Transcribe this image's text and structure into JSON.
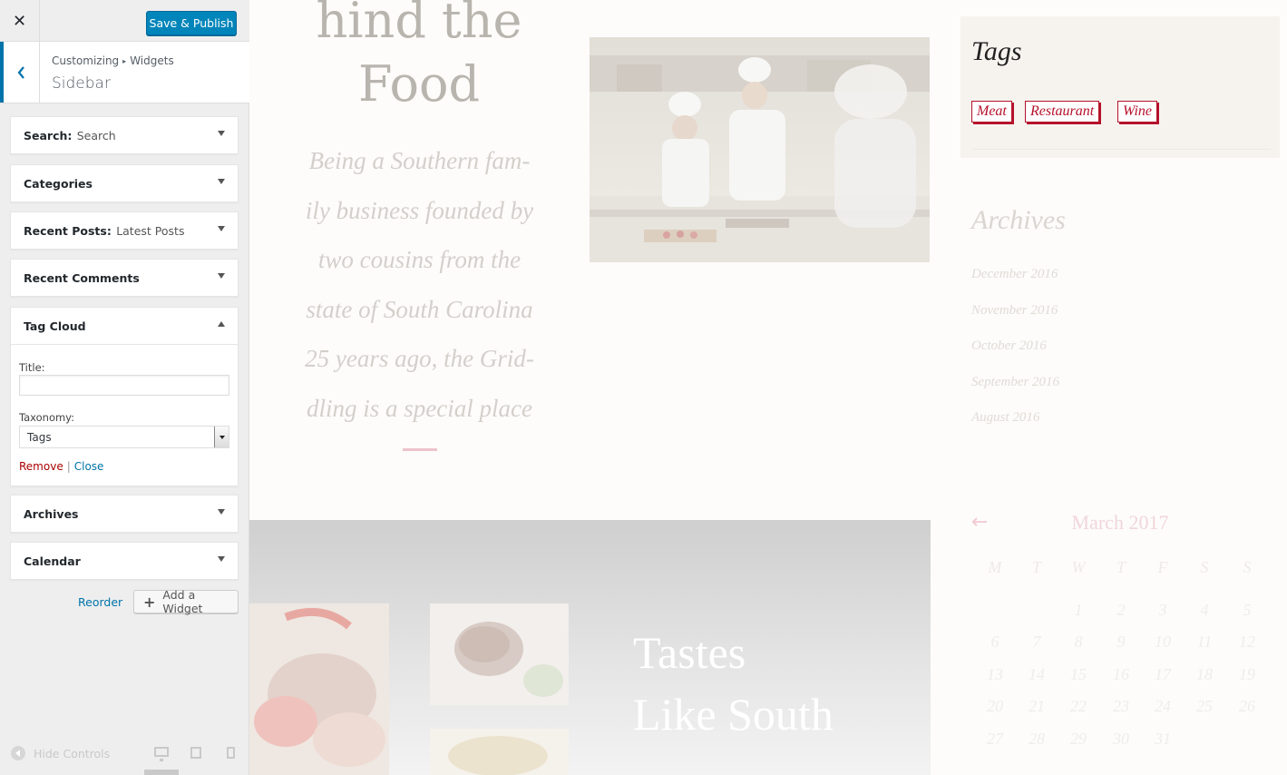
{
  "header": {
    "close_icon": "close-icon",
    "save_label": "Save & Publish"
  },
  "section": {
    "breadcrumb_root": "Customizing",
    "breadcrumb_separator": "▸",
    "breadcrumb_child": "Widgets",
    "title": "Sidebar"
  },
  "widgets": [
    {
      "title": "Search",
      "subtitle": "Search"
    },
    {
      "title": "Categories",
      "subtitle": ""
    },
    {
      "title": "Recent Posts",
      "subtitle": "Latest Posts"
    },
    {
      "title": "Recent Comments",
      "subtitle": ""
    },
    {
      "title": "Tag Cloud",
      "subtitle": ""
    },
    {
      "title": "Archives",
      "subtitle": ""
    },
    {
      "title": "Calendar",
      "subtitle": ""
    }
  ],
  "tag_cloud_form": {
    "title_label": "Title:",
    "title_value": "",
    "taxonomy_label": "Taxonomy:",
    "taxonomy_value": "Tags",
    "remove_label": "Remove",
    "separator": "|",
    "close_label": "Close"
  },
  "footer": {
    "reorder_label": "Reorder",
    "add_widget_label": "Add a Widget",
    "hide_controls_label": "Hide Controls"
  },
  "preview": {
    "hero_title_line1": "hind the",
    "hero_title_line2": "Food",
    "hero_text": [
      "Being a Southern fam-",
      "ily business founded by",
      "two cousins from the",
      "state of South Carolina",
      "25 years ago, the Grid-",
      "dling is a special place"
    ],
    "tastes_line1": "Tastes",
    "tastes_line2": "Like South",
    "tags_heading": "Tags",
    "tags": [
      "Meat",
      "Restaurant",
      "Wine"
    ],
    "archives_heading": "Archives",
    "archives": [
      "December 2016",
      "November 2016",
      "October 2016",
      "September 2016",
      "August 2016"
    ],
    "calendar": {
      "prev_arrow": "←",
      "month": "March 2017",
      "weekdays": [
        "M",
        "T",
        "W",
        "T",
        "F",
        "S",
        "S"
      ],
      "days": [
        [
          "",
          "",
          "1",
          "2",
          "3",
          "4",
          "5"
        ],
        [
          "6",
          "7",
          "8",
          "9",
          "10",
          "11",
          "12"
        ],
        [
          "13",
          "14",
          "15",
          "16",
          "17",
          "18",
          "19"
        ],
        [
          "20",
          "21",
          "22",
          "23",
          "24",
          "25",
          "26"
        ],
        [
          "27",
          "28",
          "29",
          "30",
          "31",
          "",
          ""
        ]
      ]
    }
  },
  "colors": {
    "primary_button": "#0085ba",
    "link": "#0073aa",
    "remove_link": "#aa0000",
    "tag_accent": "#b5122b"
  }
}
